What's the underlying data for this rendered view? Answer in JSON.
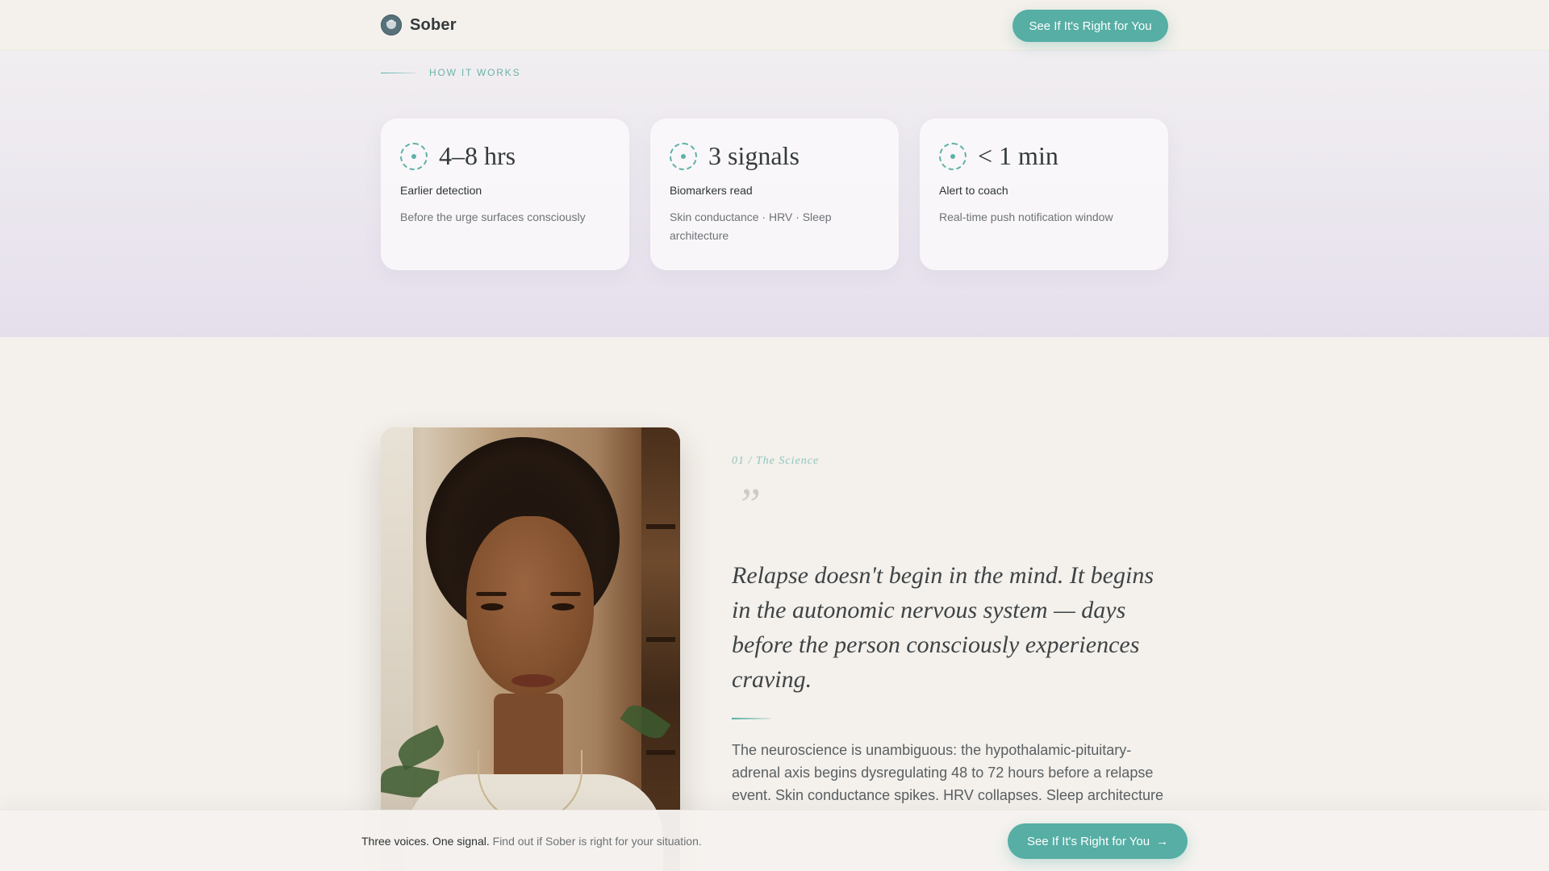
{
  "header": {
    "brand_name": "Sober",
    "cta_label": "See If It's Right for You"
  },
  "how_it_works": {
    "eyebrow": "HOW IT WORKS",
    "stats": [
      {
        "value": "4–8 hrs",
        "label": "Earlier detection",
        "description": "Before the urge surfaces consciously"
      },
      {
        "value": "3 signals",
        "label": "Biomarkers read",
        "description": "Skin conductance · HRV · Sleep architecture"
      },
      {
        "value": "< 1 min",
        "label": "Alert to coach",
        "description": "Real-time push notification window"
      }
    ]
  },
  "science": {
    "kicker": "01 / The Science",
    "quote_mark": "”",
    "quote": "Relapse doesn't begin in the mind. It begins in the autonomic nervous system — days before the person consciously experiences craving.",
    "body": "The neuroscience is unambiguous: the hypothalamic-pituitary-adrenal axis begins dysregulating 48 to 72 hours before a relapse event. Skin conductance spikes. HRV collapses. Sleep architecture"
  },
  "sticky_bar": {
    "strong_text": "Three voices. One signal.",
    "text": " Find out if Sober is right for your situation.",
    "cta_label": "See If It's Right for You",
    "cta_icon": "arrow-right-icon"
  },
  "colors": {
    "accent": "#56aea4",
    "background": "#f4f0eb",
    "section_tint": "#e5dfec"
  }
}
